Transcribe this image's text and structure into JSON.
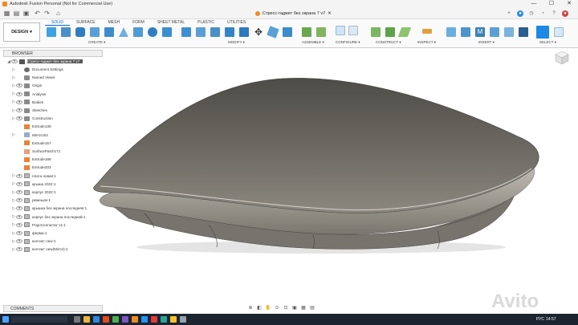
{
  "window": {
    "title": "Autodesk Fusion Personal (Not for Commercial Use)",
    "document_tab": "Стресс-гаджет без экрана 7 v7",
    "controls": [
      "—",
      "☐",
      "✕"
    ]
  },
  "ribbon": {
    "workspace": "DESIGN",
    "tabs": [
      "SOLID",
      "SURFACE",
      "MESH",
      "FORM",
      "SHEET METAL",
      "PLASTIC",
      "UTILITIES"
    ],
    "active_tab": "SOLID",
    "groups": [
      "CREATE",
      "MODIFY",
      "ASSEMBLE",
      "CONFIGURE",
      "CONSTRUCT",
      "INSPECT",
      "INSERT",
      "SELECT"
    ]
  },
  "browser": {
    "label": "BROWSER",
    "root": "Стресс-гаджет без экрана 7 v7",
    "items": [
      {
        "label": "Document Settings",
        "icon": "gear-icon",
        "expand": true,
        "eye": false
      },
      {
        "label": "Named Views",
        "icon": "folder-icon",
        "expand": true,
        "eye": false
      },
      {
        "label": "Origin",
        "icon": "folder-icon",
        "expand": true,
        "eye": true
      },
      {
        "label": "Analysis",
        "icon": "folder-icon",
        "expand": true,
        "eye": true
      },
      {
        "label": "Bodies",
        "icon": "folder-icon",
        "expand": true,
        "eye": true
      },
      {
        "label": "Sketches",
        "icon": "folder-icon",
        "expand": true,
        "eye": true
      },
      {
        "label": "Construction",
        "icon": "folder-icon",
        "expand": true,
        "eye": true
      },
      {
        "label": "Extrude139",
        "icon": "extrude-icon",
        "expand": false,
        "eye": false
      },
      {
        "label": "Mirror153",
        "icon": "mirror-icon",
        "expand": true,
        "eye": false
      },
      {
        "label": "Extrude157",
        "icon": "extrude-icon",
        "expand": false,
        "eye": false
      },
      {
        "label": "SurfacePatch171",
        "icon": "surface-icon",
        "expand": false,
        "eye": false
      },
      {
        "label": "Extrude188",
        "icon": "extrude-icon",
        "expand": false,
        "eye": false
      },
      {
        "label": "Extrude203",
        "icon": "extrude-icon",
        "expand": false,
        "eye": false
      },
      {
        "label": "плата новая:1",
        "icon": "body-icon",
        "expand": true,
        "eye": true
      },
      {
        "label": "крыша 2022:1",
        "icon": "body-icon",
        "expand": true,
        "eye": true
      },
      {
        "label": "корпус 2022:1",
        "icon": "body-icon",
        "expand": true,
        "eye": true
      },
      {
        "label": "ремешок:1",
        "icon": "body-icon",
        "expand": true,
        "eye": true
      },
      {
        "label": "крышка без экрана последняя:1",
        "icon": "body-icon",
        "expand": true,
        "eye": true
      },
      {
        "label": "корпус без экрана последний:1",
        "icon": "body-icon",
        "expand": true,
        "eye": true
      },
      {
        "label": "PogoConnector v1:1",
        "icon": "body-icon",
        "expand": true,
        "eye": true
      },
      {
        "label": "ферма:1",
        "icon": "body-icon",
        "expand": true,
        "eye": true
      },
      {
        "label": "контакт new:1",
        "icon": "body-icon",
        "expand": true,
        "eye": true
      },
      {
        "label": "контакт new(Mirror):1",
        "icon": "body-icon",
        "expand": true,
        "eye": true
      }
    ]
  },
  "comments": {
    "label": "COMMENTS"
  },
  "taskbar": {
    "lang": "РУС",
    "time": "14:57"
  },
  "watermark": "Avito",
  "colors": {
    "accent": "#0a6ad0",
    "taskbar": "#1c2430",
    "model": "#6d6a63"
  }
}
